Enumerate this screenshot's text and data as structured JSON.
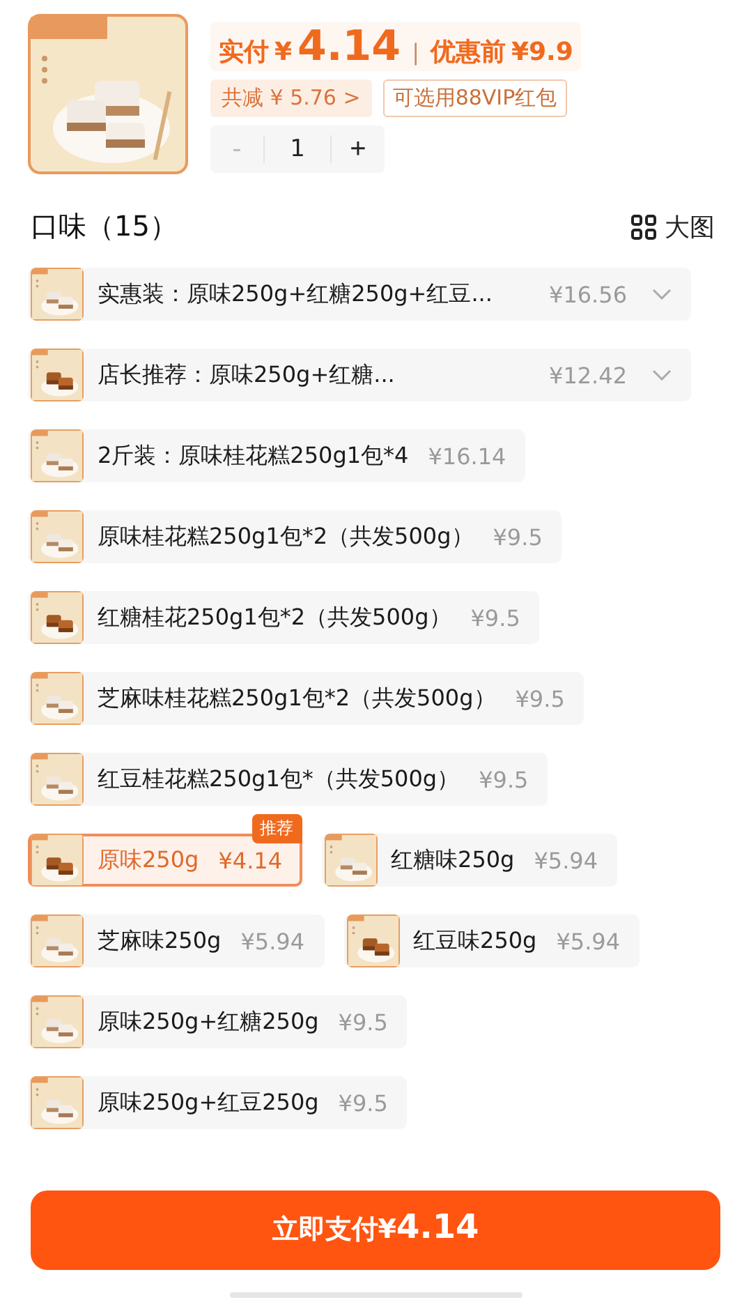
{
  "price": {
    "paid_label": "实付",
    "currency": "¥",
    "paid_amount": "4.14",
    "separator": "|",
    "original_label": "优惠前",
    "original_price": "¥9.9"
  },
  "discount_tag": "共减 ¥ 5.76 >",
  "vip_tag": "可选用88VIP红包",
  "quantity": {
    "minus": "-",
    "value": "1",
    "plus": "+",
    "minus_disabled": true
  },
  "section": {
    "title": "口味（15）",
    "view_toggle": "大图"
  },
  "option_rows": [
    [
      {
        "label": "实惠装：原味250g+红糖250g+红豆...",
        "price": "¥16.56",
        "selected": false,
        "expandable": true,
        "wide": true
      }
    ],
    [
      {
        "label": "店长推荐：原味250g+红糖...",
        "price": "¥12.42",
        "selected": false,
        "expandable": true,
        "wide": true
      }
    ],
    [
      {
        "label": "2斤装：原味桂花糕250g1包*4",
        "price": "¥16.14",
        "selected": false,
        "expandable": false
      }
    ],
    [
      {
        "label": "原味桂花糕250g1包*2（共发500g）",
        "price": "¥9.5",
        "selected": false,
        "expandable": false
      }
    ],
    [
      {
        "label": "红糖桂花250g1包*2（共发500g）",
        "price": "¥9.5",
        "selected": false,
        "expandable": false
      }
    ],
    [
      {
        "label": "芝麻味桂花糕250g1包*2（共发500g）",
        "price": "¥9.5",
        "selected": false,
        "expandable": false
      }
    ],
    [
      {
        "label": "红豆桂花糕250g1包*（共发500g）",
        "price": "¥9.5",
        "selected": false,
        "expandable": false
      }
    ],
    [
      {
        "label": "原味250g",
        "price": "¥4.14",
        "selected": true,
        "expandable": false,
        "badge": "推荐"
      },
      {
        "label": "红糖味250g",
        "price": "¥5.94",
        "selected": false,
        "expandable": false
      }
    ],
    [
      {
        "label": "芝麻味250g",
        "price": "¥5.94",
        "selected": false,
        "expandable": false
      },
      {
        "label": "红豆味250g",
        "price": "¥5.94",
        "selected": false,
        "expandable": false
      }
    ],
    [
      {
        "label": "原味250g+红糖250g",
        "price": "¥9.5",
        "selected": false,
        "expandable": false
      }
    ],
    [
      {
        "label": "原味250g+红豆250g",
        "price": "¥9.5",
        "selected": false,
        "expandable": false
      }
    ]
  ],
  "pay_button": {
    "label": "立即支付",
    "currency": "¥",
    "amount": "4.14"
  }
}
